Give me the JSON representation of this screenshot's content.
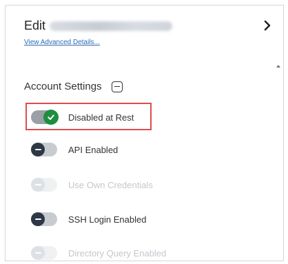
{
  "header": {
    "title": "Edit",
    "advanced_link": "View Advanced Details..."
  },
  "section": {
    "title": "Account Settings"
  },
  "settings": [
    {
      "label": "Disabled at Rest",
      "state": "on"
    },
    {
      "label": "API Enabled",
      "state": "off"
    },
    {
      "label": "Use Own Credentials",
      "state": "disabled"
    },
    {
      "label": "SSH Login Enabled",
      "state": "off"
    },
    {
      "label": "Directory Query Enabled",
      "state": "disabled"
    }
  ],
  "colors": {
    "highlight": "#e04b4b",
    "toggle_on": "#1e8e3e",
    "toggle_off_knob": "#2e3745",
    "link": "#2a6ab8"
  }
}
